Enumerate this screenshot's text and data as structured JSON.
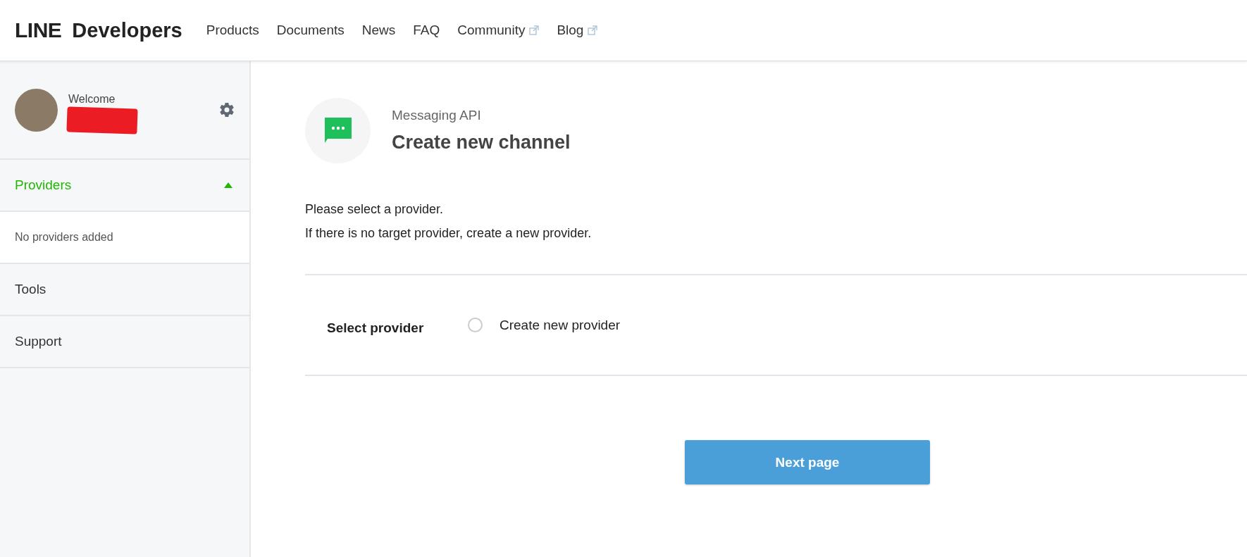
{
  "header": {
    "logo": "LINE",
    "logo_suffix": "Developers",
    "nav": [
      {
        "label": "Products",
        "external": false
      },
      {
        "label": "Documents",
        "external": false
      },
      {
        "label": "News",
        "external": false
      },
      {
        "label": "FAQ",
        "external": false
      },
      {
        "label": "Community",
        "external": true
      },
      {
        "label": "Blog",
        "external": true
      }
    ]
  },
  "sidebar": {
    "user": {
      "greeting": "Welcome",
      "redacted": true
    },
    "sections": [
      {
        "label": "Providers",
        "expanded": true,
        "children": [
          {
            "label": "No providers added"
          }
        ]
      },
      {
        "label": "Tools",
        "expanded": false
      },
      {
        "label": "Support",
        "expanded": false
      }
    ]
  },
  "main": {
    "subtitle": "Messaging API",
    "title": "Create new channel",
    "instructions": [
      "Please select a provider.",
      "If there is no target provider, create a new provider."
    ],
    "field_label": "Select provider",
    "options": [
      {
        "label": "Create new provider",
        "selected": false
      }
    ],
    "next_button": "Next page"
  }
}
